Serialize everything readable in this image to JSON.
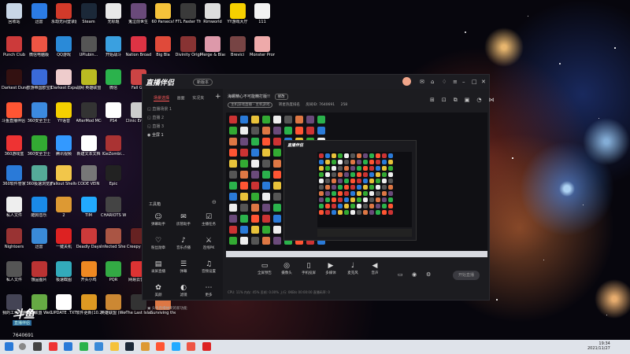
{
  "desktop": {
    "icons": [
      {
        "label": "回收站",
        "color": "#c8d6e6"
      },
      {
        "label": "迅雷",
        "color": "#2b7be4"
      },
      {
        "label": "永劫无间登录器",
        "color": "#d23a2a"
      },
      {
        "label": "Steam",
        "color": "#1b2838"
      },
      {
        "label": "无标题",
        "color": "#e8e8e8"
      },
      {
        "label": "鬼泣前世生",
        "color": "#6a4a7a"
      },
      {
        "label": "60 Parsecs!",
        "color": "#f5c23a"
      },
      {
        "label": "FTL Faster Than Light",
        "color": "#3a3a3a"
      },
      {
        "label": "Rimworld",
        "color": "#ddd"
      },
      {
        "label": "YY游戏大厅",
        "color": "#f6d000"
      },
      {
        "label": "111",
        "color": "#f2f2f2"
      },
      {
        "label": "Punch Club",
        "color": "#cc3a3a"
      },
      {
        "label": "微信电脑版",
        "color": "#e54"
      },
      {
        "label": "QQ游戏",
        "color": "#2a8ad8"
      },
      {
        "label": "UPlubin...",
        "color": "#555"
      },
      {
        "label": "开始战斗",
        "color": "#3aa0e0"
      },
      {
        "label": "Nation Broadcast",
        "color": "#d34"
      },
      {
        "label": "Big Bla",
        "color": "#e04a3a"
      },
      {
        "label": "Divinity Original",
        "color": "#833"
      },
      {
        "label": "Merge & Blade",
        "color": "#d9a"
      },
      {
        "label": "Brevici",
        "color": "#744"
      },
      {
        "label": "Monster Prom",
        "color": "#eaa"
      },
      {
        "label": "Darkest Dungeon",
        "color": "#311"
      },
      {
        "label": "欧游帝国欧宝数据",
        "color": "#3a6ad8"
      },
      {
        "label": "Darkest Expedition",
        "color": "#ecc"
      },
      {
        "label": "战网 英雄联盟",
        "color": "#bb2"
      },
      {
        "label": "微信",
        "color": "#2bb24c"
      },
      {
        "label": "Fall Gu",
        "color": "#c44"
      },
      {
        "label": "斗鱼直播伴侣 打工单",
        "color": "#f53"
      },
      {
        "label": "360安全卫士",
        "color": "#3c8ae0"
      },
      {
        "label": "YY语音",
        "color": "#f5d000"
      },
      {
        "label": "AfterMod MCentral",
        "color": "#333"
      },
      {
        "label": "PS4",
        "color": "#fff"
      },
      {
        "label": "Clinic Empire",
        "color": "#ccc"
      },
      {
        "label": "360游戏盒",
        "color": "#e33"
      },
      {
        "label": "360安全卫士",
        "color": "#3a3"
      },
      {
        "label": "腾讯视频",
        "color": "#39f"
      },
      {
        "label": "新建文本文档",
        "color": "#fff"
      },
      {
        "label": "IGeZombi...",
        "color": "#a33"
      },
      {
        "label": "360软件管家",
        "color": "#2a7ad8"
      },
      {
        "label": "360极速浏览器",
        "color": "#5a9"
      },
      {
        "label": "Fallout Shelter",
        "color": "#f2c64a"
      },
      {
        "label": "CODE VEIN",
        "color": "#777"
      },
      {
        "label": "Epic",
        "color": "#222"
      },
      {
        "label": "私人文件",
        "color": "#eee"
      },
      {
        "label": "酷狗音乐",
        "color": "#1a8ae8"
      },
      {
        "label": "2",
        "color": "#d93"
      },
      {
        "label": "TIM",
        "color": "#2af"
      },
      {
        "label": "CHARIOTS Wonder",
        "color": "#444"
      },
      {
        "label": "Nightoers",
        "color": "#933"
      },
      {
        "label": "迅雷",
        "color": "#3a8ad8"
      },
      {
        "label": "一键关机",
        "color": "#d22"
      },
      {
        "label": "Deadly Days",
        "color": "#cc3a3a"
      },
      {
        "label": "Infected Shelter",
        "color": "#a54"
      },
      {
        "label": "Creepy Tale",
        "color": "#622"
      },
      {
        "label": "私人文件",
        "color": "#555"
      },
      {
        "label": "饿品图片",
        "color": "#b33"
      },
      {
        "label": "极速截图",
        "color": "#3ab"
      },
      {
        "label": "开头小鸡",
        "color": "#e82"
      },
      {
        "label": "PQR",
        "color": "#3a4"
      },
      {
        "label": "网易云音乐",
        "color": "#d33"
      },
      {
        "label": "我的工作电脑",
        "color": "#445"
      },
      {
        "label": "英雄联盟 WeGame版",
        "color": "#6a4"
      },
      {
        "label": "UPDATE .TXT",
        "color": "#fff"
      },
      {
        "label": "软件更新(10.29.)SD",
        "color": "#d92"
      },
      {
        "label": "英雄联盟 (WeGame)",
        "color": "#c83"
      },
      {
        "label": "The Last Island",
        "color": "#333"
      },
      {
        "label": "Surviving the Abyss",
        "color": "#d74"
      }
    ]
  },
  "overlay": {
    "brand": "斗鱼",
    "tag": "直播伴侣",
    "room_id": "7640691"
  },
  "app": {
    "logo": "直播伴侣",
    "version": "新版本",
    "tabs": [
      "场景选择",
      "画面",
      "实况夹"
    ],
    "scenes": [
      "直播场景 1",
      "直播 2",
      "直播 3",
      "全屏 1"
    ],
    "tools_title": "工具箱",
    "tools": [
      "弹幕助手",
      "房管助手",
      "主播任务",
      "粉丝勋章",
      "音乐点播",
      "连线PK",
      "录屏直播",
      "弹幕",
      "音频设置",
      "美颜",
      "滤镜",
      "更多"
    ],
    "status_line": "头条直播抽奖的新功能",
    "title_text": "海螺精心不可能精打版!!",
    "title_tag": "修改",
    "meta": [
      "主机游戏直播 - 主机游戏",
      "转星热度排名",
      "房间ID: 7640691",
      "258"
    ],
    "preview_window_title": "直播伴侣",
    "bottom_actions": [
      "全屏预告",
      "摄像头",
      "手机投屏",
      "多媒体",
      "麦克风",
      "音声"
    ],
    "go_live": "开始直播",
    "stats": "CPU: 11%  内存: 45%  丢帧: 0.00%  上行: 0KB/s  00:00:00  直播码率: 0"
  },
  "taskbar": {
    "time": "19:34",
    "date": "2021/11/27"
  }
}
